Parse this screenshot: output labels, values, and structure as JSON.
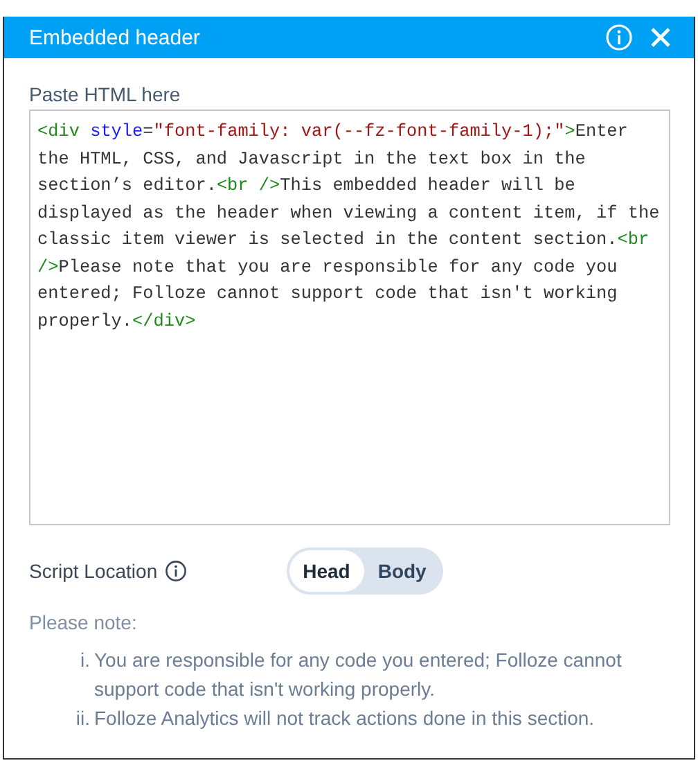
{
  "dialog": {
    "title": "Embedded header"
  },
  "html_field": {
    "label": "Paste HTML here",
    "code": [
      {
        "kind": "tag",
        "text": "<div "
      },
      {
        "kind": "attr",
        "text": "style"
      },
      {
        "kind": "text",
        "text": "="
      },
      {
        "kind": "string",
        "text": "\"font-family: var(--fz-font-family-1);\""
      },
      {
        "kind": "tag",
        "text": ">"
      },
      {
        "kind": "text",
        "text": "Enter the HTML, CSS, and Javascript in the text box in the section’s editor."
      },
      {
        "kind": "tag",
        "text": "<br />"
      },
      {
        "kind": "text",
        "text": "This embedded header will be displayed as the header when viewing a content item, if the classic item viewer is selected in the content section."
      },
      {
        "kind": "tag",
        "text": "<br />"
      },
      {
        "kind": "text",
        "text": "Please note that you are responsible for any code you entered; Folloze cannot support code that isn't working properly."
      },
      {
        "kind": "tag",
        "text": "</div>"
      }
    ]
  },
  "script_location": {
    "label": "Script Location",
    "options": [
      {
        "label": "Head",
        "selected": true
      },
      {
        "label": "Body",
        "selected": false
      }
    ]
  },
  "note": {
    "title": "Please note:",
    "items": [
      {
        "marker": "i.",
        "text": "You are responsible for any code you entered; Folloze cannot support code that isn't working properly."
      },
      {
        "marker": "ii.",
        "text": "Folloze Analytics will not track actions done in this section."
      }
    ]
  }
}
